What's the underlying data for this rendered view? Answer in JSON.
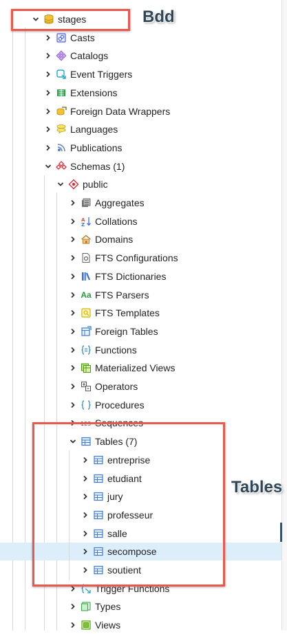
{
  "tree": {
    "db": {
      "label": "stages",
      "icon": "database-icon"
    },
    "db_children": [
      {
        "label": "Casts",
        "icon": "casts-icon"
      },
      {
        "label": "Catalogs",
        "icon": "catalogs-icon"
      },
      {
        "label": "Event Triggers",
        "icon": "event-triggers-icon"
      },
      {
        "label": "Extensions",
        "icon": "extensions-icon"
      },
      {
        "label": "Foreign Data Wrappers",
        "icon": "foreign-data-wrappers-icon"
      },
      {
        "label": "Languages",
        "icon": "languages-icon"
      },
      {
        "label": "Publications",
        "icon": "publications-icon"
      },
      {
        "label": "Schemas (1)",
        "icon": "schemas-icon"
      }
    ],
    "schema": {
      "label": "public",
      "icon": "schema-icon"
    },
    "schema_children": [
      {
        "label": "Aggregates",
        "icon": "aggregates-icon"
      },
      {
        "label": "Collations",
        "icon": "collations-icon"
      },
      {
        "label": "Domains",
        "icon": "domains-icon"
      },
      {
        "label": "FTS Configurations",
        "icon": "fts-configurations-icon"
      },
      {
        "label": "FTS Dictionaries",
        "icon": "fts-dictionaries-icon"
      },
      {
        "label": "FTS Parsers",
        "icon": "fts-parsers-icon"
      },
      {
        "label": "FTS Templates",
        "icon": "fts-templates-icon"
      },
      {
        "label": "Foreign Tables",
        "icon": "foreign-tables-icon"
      },
      {
        "label": "Functions",
        "icon": "functions-icon"
      },
      {
        "label": "Materialized Views",
        "icon": "materialized-views-icon"
      },
      {
        "label": "Operators",
        "icon": "operators-icon"
      },
      {
        "label": "Procedures",
        "icon": "procedures-icon"
      },
      {
        "label": "Sequences",
        "icon": "sequences-icon"
      },
      {
        "label": "Tables (7)",
        "icon": "tables-icon"
      }
    ],
    "tables": [
      {
        "label": "entreprise",
        "icon": "table-icon"
      },
      {
        "label": "etudiant",
        "icon": "table-icon"
      },
      {
        "label": "jury",
        "icon": "table-icon"
      },
      {
        "label": "professeur",
        "icon": "table-icon"
      },
      {
        "label": "salle",
        "icon": "table-icon"
      },
      {
        "label": "secompose",
        "icon": "table-icon",
        "selected": true
      },
      {
        "label": "soutient",
        "icon": "table-icon"
      }
    ],
    "after_tables": [
      {
        "label": "Trigger Functions",
        "icon": "trigger-functions-icon"
      },
      {
        "label": "Types",
        "icon": "types-icon"
      },
      {
        "label": "Views",
        "icon": "views-icon"
      }
    ]
  },
  "annotations": {
    "bdd_label": "Bdd",
    "tables_label": "Tables",
    "box_color": "#e8584c",
    "selection_color": "#ddeefb"
  }
}
